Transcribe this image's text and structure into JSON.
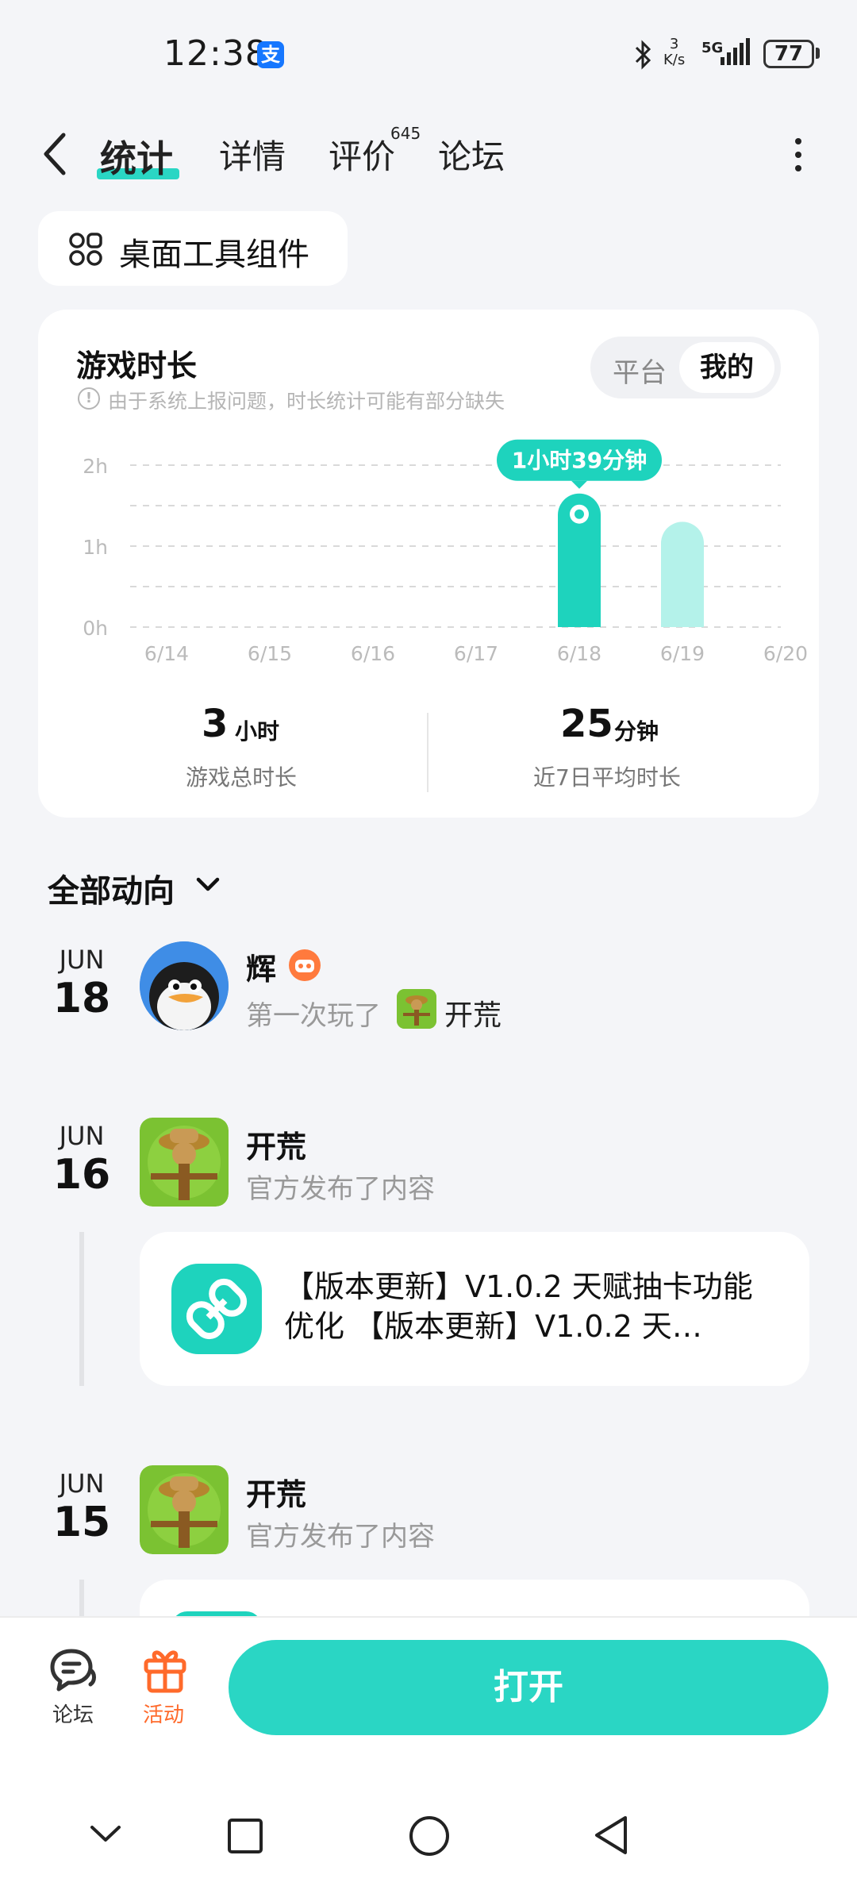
{
  "status_bar": {
    "time": "12:38",
    "alipay_glyph": "支",
    "net_speed_value": "3",
    "net_speed_unit": "K/s",
    "network": "5G",
    "battery": "77"
  },
  "nav": {
    "tabs": [
      {
        "label": "统计",
        "active": true
      },
      {
        "label": "详情"
      },
      {
        "label": "评价",
        "badge": "645"
      },
      {
        "label": "论坛"
      }
    ]
  },
  "widget_chip": {
    "label": "桌面工具组件",
    "icon": "widgets-icon"
  },
  "playtime": {
    "title": "游戏时长",
    "notice": "由于系统上报问题，时长统计可能有部分缺失",
    "toggle": {
      "platform": "平台",
      "mine": "我的"
    },
    "stats": {
      "total_value": "3",
      "total_unit": "小时",
      "total_label": "游戏总时长",
      "avg_value": "25",
      "avg_unit": "分钟",
      "avg_label": "近7日平均时长"
    }
  },
  "chart_data": {
    "type": "bar",
    "categories": [
      "6/14",
      "6/15",
      "6/16",
      "6/17",
      "6/18",
      "6/19",
      "6/20"
    ],
    "values": [
      0,
      0,
      0,
      0,
      1.65,
      1.3,
      0
    ],
    "ylim": [
      0,
      2
    ],
    "yticks": [
      "0h",
      "1h",
      "2h"
    ],
    "highlighted_index": 4,
    "tooltip": "1小时39分钟",
    "colors": {
      "bar": "#1ed3bd",
      "bar_light": "#b4f2ea",
      "tooltip": "#1ed3bd"
    }
  },
  "feed": {
    "filter_label": "全部动向",
    "items": [
      {
        "month": "JUN",
        "day": "18",
        "name": "辉",
        "sub_prefix": "第一次玩了",
        "game": "开荒"
      },
      {
        "month": "JUN",
        "day": "16",
        "name": "开荒",
        "sub": "官方发布了内容",
        "post_text": "【版本更新】V1.0.2 天赋抽卡功能优化 【版本更新】V1.0.2 天…"
      },
      {
        "month": "JUN",
        "day": "15",
        "name": "开荒",
        "sub": "官方发布了内容"
      }
    ]
  },
  "bottom_bar": {
    "forum_label": "论坛",
    "event_label": "活动",
    "open_label": "打开",
    "accent": "#2ad6c4",
    "event_color": "#ff6a2b"
  }
}
